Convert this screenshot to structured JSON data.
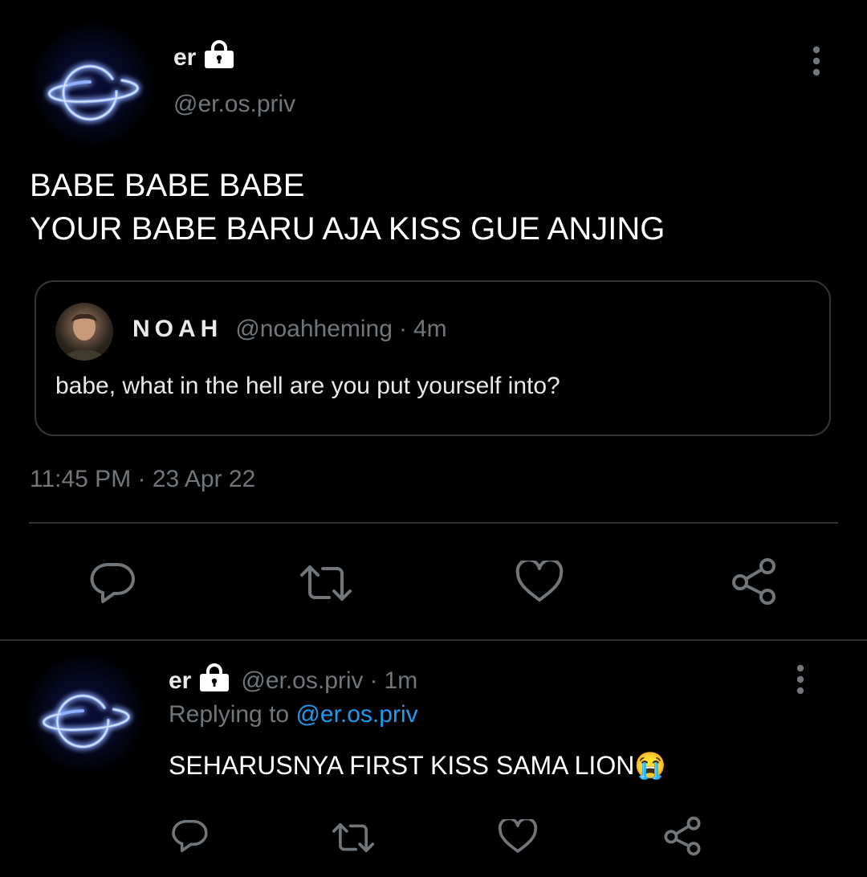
{
  "main_tweet": {
    "author_name": "er",
    "handle": "@er.os.priv",
    "text": "BABE BABE BABE\nYOUR BABE BARU AJA KISS GUE ANJING",
    "timestamp": "11:45 PM · 23 Apr 22"
  },
  "quoted_tweet": {
    "author_name": "NOAH",
    "handle": "@noahheming",
    "separator": "·",
    "time": "4m",
    "text": "babe, what in the hell are you put yourself into?"
  },
  "reply": {
    "author_name": "er",
    "handle": "@er.os.priv",
    "separator": "·",
    "time": "1m",
    "replying_prefix": "Replying to",
    "replying_to": "@er.os.priv",
    "text": "SEHARUSNYA FIRST KISS SAMA LION",
    "emoji": "😭"
  },
  "icons": {
    "reply": "reply-icon",
    "retweet": "retweet-icon",
    "like": "like-icon",
    "share": "share-icon",
    "more": "more-icon",
    "lock": "lock-icon"
  },
  "colors": {
    "background": "#000000",
    "text": "#e7e9ea",
    "muted": "#71767b",
    "link": "#1d9bf0",
    "border": "#2f3336",
    "avatar_glow": "#3b5bff"
  }
}
